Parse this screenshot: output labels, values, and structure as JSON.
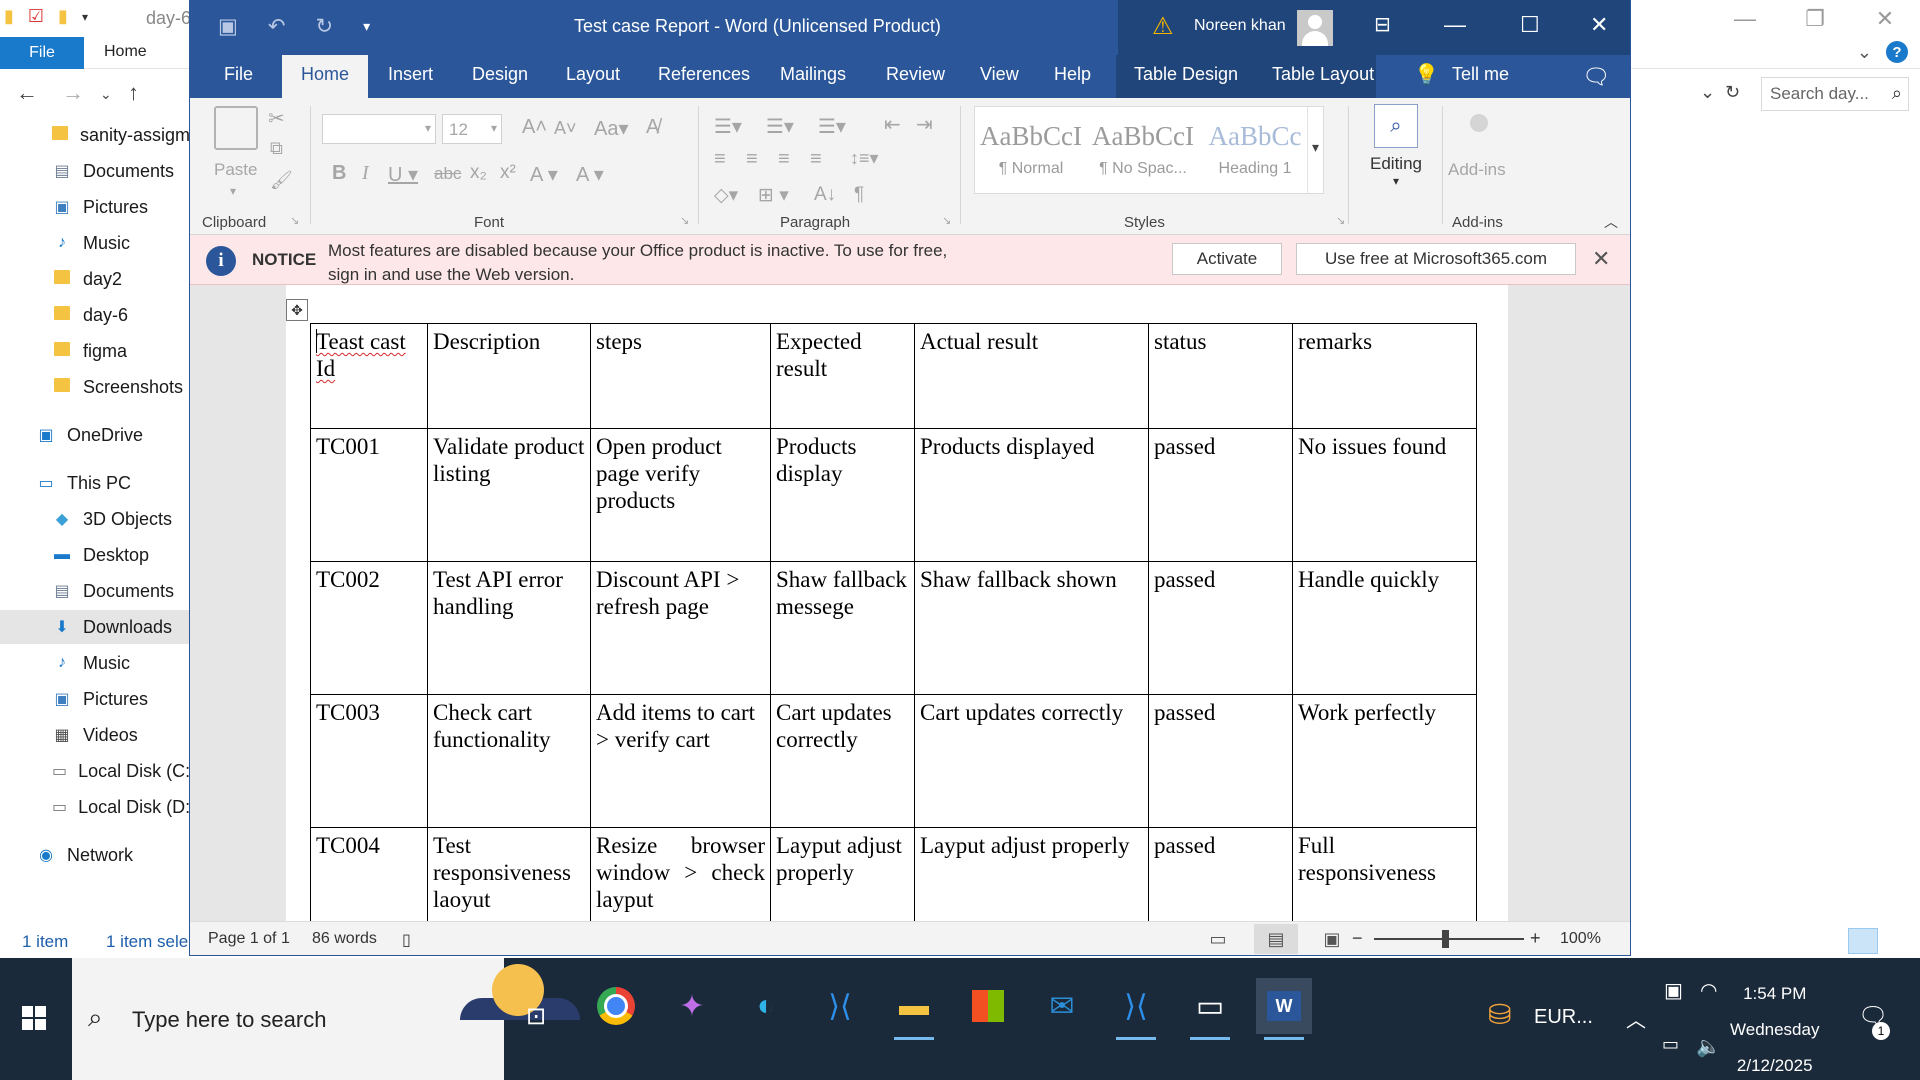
{
  "explorer": {
    "title": "day-6",
    "ribbon": {
      "file_label": "File",
      "home_label": "Home"
    },
    "search_placeholder": "Search day...",
    "sidebar": [
      {
        "label": "sanity-assigm",
        "icon": "folder-icon"
      },
      {
        "label": "Documents",
        "icon": "documents-icon"
      },
      {
        "label": "Pictures",
        "icon": "pictures-icon"
      },
      {
        "label": "Music",
        "icon": "music-icon"
      },
      {
        "label": "day2",
        "icon": "folder-icon"
      },
      {
        "label": "day-6",
        "icon": "folder-icon"
      },
      {
        "label": "figma",
        "icon": "folder-icon"
      },
      {
        "label": "Screenshots",
        "icon": "folder-icon"
      },
      {
        "label": "OneDrive",
        "icon": "onedrive-icon"
      },
      {
        "label": "This PC",
        "icon": "pc-icon"
      },
      {
        "label": "3D Objects",
        "icon": "3d-objects-icon"
      },
      {
        "label": "Desktop",
        "icon": "desktop-icon"
      },
      {
        "label": "Documents",
        "icon": "documents-icon"
      },
      {
        "label": "Downloads",
        "icon": "downloads-icon"
      },
      {
        "label": "Music",
        "icon": "music-icon"
      },
      {
        "label": "Pictures",
        "icon": "pictures-icon"
      },
      {
        "label": "Videos",
        "icon": "videos-icon"
      },
      {
        "label": "Local Disk (C:)",
        "icon": "drive-icon"
      },
      {
        "label": "Local Disk (D:)",
        "icon": "drive-icon"
      },
      {
        "label": "Network",
        "icon": "network-icon"
      }
    ],
    "status": {
      "count": "1 item",
      "selected": "1 item sele"
    }
  },
  "word": {
    "title": "Test case Report  -  Word (Unlicensed Product)",
    "user_name": "Noreen khan",
    "tabs": [
      "File",
      "Home",
      "Insert",
      "Design",
      "Layout",
      "References",
      "Mailings",
      "Review",
      "View",
      "Help",
      "Table Design",
      "Table Layout"
    ],
    "tell_me": "Tell me",
    "ribbon": {
      "paste_label": "Paste",
      "font_size": "12",
      "groups": [
        "Clipboard",
        "Font",
        "Paragraph",
        "Styles",
        "Add-ins"
      ],
      "styles": [
        {
          "preview": "AaBbCcI",
          "name": "¶ Normal"
        },
        {
          "preview": "AaBbCcI",
          "name": "¶ No Spac..."
        },
        {
          "preview": "AaBbCc",
          "name": "Heading 1"
        }
      ],
      "editing_label": "Editing",
      "addins_label": "Add-ins"
    },
    "notice": {
      "label": "NOTICE",
      "message": "Most features are disabled because your Office product is inactive. To use for free, sign in and use the Web version.",
      "activate_label": "Activate",
      "use_free_label": "Use free at Microsoft365.com"
    },
    "table": {
      "headers": [
        "Teast cast Id",
        "Description",
        "steps",
        "Expected result",
        "Actual result",
        "status",
        "remarks"
      ],
      "rows": [
        [
          "TC001",
          "Validate product listing",
          "Open product page verify products",
          "Products display",
          "Products displayed",
          "passed",
          "No issues  found"
        ],
        [
          "TC002",
          "Test API error handling",
          "Discount API > refresh page",
          "Shaw fallback messege",
          "Shaw fallback shown",
          "passed",
          "Handle quickly"
        ],
        [
          "TC003",
          "Check cart functionality",
          "Add items to cart > verify cart",
          "Cart updates correctly",
          "Cart updates correctly",
          "passed",
          "Work perfectly"
        ],
        [
          "TC004",
          "Test responsiveness laoyut",
          "Resize browser window > check layput",
          "Layput adjust properly",
          "Layput adjust properly",
          "passed",
          "Full responsiveness"
        ]
      ]
    },
    "status_bar": {
      "page": "Page 1 of 1",
      "words": "86 words",
      "zoom": "100%"
    }
  },
  "taskbar": {
    "search_placeholder": "Type here to search",
    "apps": [
      "chrome-icon",
      "copilot-icon",
      "edge-icon",
      "vscode-icon",
      "file-explorer-icon",
      "store-icon",
      "outlook-icon",
      "vscode-icon",
      "terminal-icon",
      "word-icon"
    ],
    "currency": "EUR...",
    "time": "1:54 PM",
    "day": "Wednesday",
    "date": "2/12/2025",
    "notifications": "1"
  }
}
